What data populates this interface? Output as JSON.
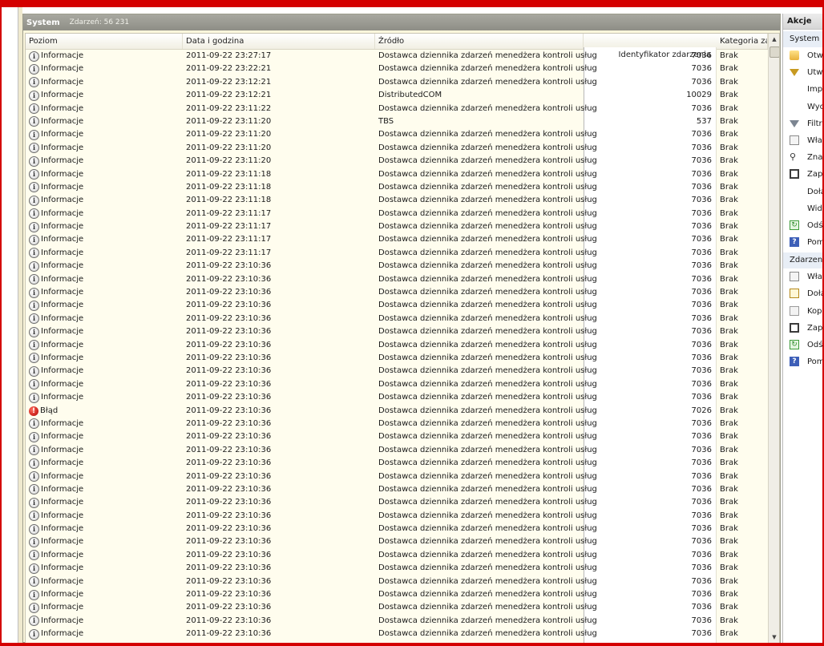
{
  "panel": {
    "title": "System",
    "count": "Zdarzeń: 56 231"
  },
  "columns": {
    "level": "Poziom",
    "date": "Data i godzina",
    "source": "Źródło",
    "event_id": "Identyfikator zdarzenia",
    "category": "Kategoria zad"
  },
  "rows": [
    {
      "level": "Informacje",
      "type": "info",
      "date": "2011-09-22 23:27:17",
      "source": "Dostawca dziennika zdarzeń menedżera kontroli usług",
      "id": "7036",
      "cat": "Brak"
    },
    {
      "level": "Informacje",
      "type": "info",
      "date": "2011-09-22 23:22:21",
      "source": "Dostawca dziennika zdarzeń menedżera kontroli usług",
      "id": "7036",
      "cat": "Brak"
    },
    {
      "level": "Informacje",
      "type": "info",
      "date": "2011-09-22 23:12:21",
      "source": "Dostawca dziennika zdarzeń menedżera kontroli usług",
      "id": "7036",
      "cat": "Brak"
    },
    {
      "level": "Informacje",
      "type": "info",
      "date": "2011-09-22 23:12:21",
      "source": "DistributedCOM",
      "id": "10029",
      "cat": "Brak"
    },
    {
      "level": "Informacje",
      "type": "info",
      "date": "2011-09-22 23:11:22",
      "source": "Dostawca dziennika zdarzeń menedżera kontroli usług",
      "id": "7036",
      "cat": "Brak"
    },
    {
      "level": "Informacje",
      "type": "info",
      "date": "2011-09-22 23:11:20",
      "source": "TBS",
      "id": "537",
      "cat": "Brak"
    },
    {
      "level": "Informacje",
      "type": "info",
      "date": "2011-09-22 23:11:20",
      "source": "Dostawca dziennika zdarzeń menedżera kontroli usług",
      "id": "7036",
      "cat": "Brak"
    },
    {
      "level": "Informacje",
      "type": "info",
      "date": "2011-09-22 23:11:20",
      "source": "Dostawca dziennika zdarzeń menedżera kontroli usług",
      "id": "7036",
      "cat": "Brak"
    },
    {
      "level": "Informacje",
      "type": "info",
      "date": "2011-09-22 23:11:20",
      "source": "Dostawca dziennika zdarzeń menedżera kontroli usług",
      "id": "7036",
      "cat": "Brak"
    },
    {
      "level": "Informacje",
      "type": "info",
      "date": "2011-09-22 23:11:18",
      "source": "Dostawca dziennika zdarzeń menedżera kontroli usług",
      "id": "7036",
      "cat": "Brak"
    },
    {
      "level": "Informacje",
      "type": "info",
      "date": "2011-09-22 23:11:18",
      "source": "Dostawca dziennika zdarzeń menedżera kontroli usług",
      "id": "7036",
      "cat": "Brak"
    },
    {
      "level": "Informacje",
      "type": "info",
      "date": "2011-09-22 23:11:18",
      "source": "Dostawca dziennika zdarzeń menedżera kontroli usług",
      "id": "7036",
      "cat": "Brak"
    },
    {
      "level": "Informacje",
      "type": "info",
      "date": "2011-09-22 23:11:17",
      "source": "Dostawca dziennika zdarzeń menedżera kontroli usług",
      "id": "7036",
      "cat": "Brak"
    },
    {
      "level": "Informacje",
      "type": "info",
      "date": "2011-09-22 23:11:17",
      "source": "Dostawca dziennika zdarzeń menedżera kontroli usług",
      "id": "7036",
      "cat": "Brak"
    },
    {
      "level": "Informacje",
      "type": "info",
      "date": "2011-09-22 23:11:17",
      "source": "Dostawca dziennika zdarzeń menedżera kontroli usług",
      "id": "7036",
      "cat": "Brak"
    },
    {
      "level": "Informacje",
      "type": "info",
      "date": "2011-09-22 23:11:17",
      "source": "Dostawca dziennika zdarzeń menedżera kontroli usług",
      "id": "7036",
      "cat": "Brak"
    },
    {
      "level": "Informacje",
      "type": "info",
      "date": "2011-09-22 23:10:36",
      "source": "Dostawca dziennika zdarzeń menedżera kontroli usług",
      "id": "7036",
      "cat": "Brak"
    },
    {
      "level": "Informacje",
      "type": "info",
      "date": "2011-09-22 23:10:36",
      "source": "Dostawca dziennika zdarzeń menedżera kontroli usług",
      "id": "7036",
      "cat": "Brak"
    },
    {
      "level": "Informacje",
      "type": "info",
      "date": "2011-09-22 23:10:36",
      "source": "Dostawca dziennika zdarzeń menedżera kontroli usług",
      "id": "7036",
      "cat": "Brak"
    },
    {
      "level": "Informacje",
      "type": "info",
      "date": "2011-09-22 23:10:36",
      "source": "Dostawca dziennika zdarzeń menedżera kontroli usług",
      "id": "7036",
      "cat": "Brak"
    },
    {
      "level": "Informacje",
      "type": "info",
      "date": "2011-09-22 23:10:36",
      "source": "Dostawca dziennika zdarzeń menedżera kontroli usług",
      "id": "7036",
      "cat": "Brak"
    },
    {
      "level": "Informacje",
      "type": "info",
      "date": "2011-09-22 23:10:36",
      "source": "Dostawca dziennika zdarzeń menedżera kontroli usług",
      "id": "7036",
      "cat": "Brak"
    },
    {
      "level": "Informacje",
      "type": "info",
      "date": "2011-09-22 23:10:36",
      "source": "Dostawca dziennika zdarzeń menedżera kontroli usług",
      "id": "7036",
      "cat": "Brak"
    },
    {
      "level": "Informacje",
      "type": "info",
      "date": "2011-09-22 23:10:36",
      "source": "Dostawca dziennika zdarzeń menedżera kontroli usług",
      "id": "7036",
      "cat": "Brak"
    },
    {
      "level": "Informacje",
      "type": "info",
      "date": "2011-09-22 23:10:36",
      "source": "Dostawca dziennika zdarzeń menedżera kontroli usług",
      "id": "7036",
      "cat": "Brak"
    },
    {
      "level": "Informacje",
      "type": "info",
      "date": "2011-09-22 23:10:36",
      "source": "Dostawca dziennika zdarzeń menedżera kontroli usług",
      "id": "7036",
      "cat": "Brak"
    },
    {
      "level": "Informacje",
      "type": "info",
      "date": "2011-09-22 23:10:36",
      "source": "Dostawca dziennika zdarzeń menedżera kontroli usług",
      "id": "7036",
      "cat": "Brak"
    },
    {
      "level": "Błąd",
      "type": "error",
      "date": "2011-09-22 23:10:36",
      "source": "Dostawca dziennika zdarzeń menedżera kontroli usług",
      "id": "7026",
      "cat": "Brak"
    },
    {
      "level": "Informacje",
      "type": "info",
      "date": "2011-09-22 23:10:36",
      "source": "Dostawca dziennika zdarzeń menedżera kontroli usług",
      "id": "7036",
      "cat": "Brak"
    },
    {
      "level": "Informacje",
      "type": "info",
      "date": "2011-09-22 23:10:36",
      "source": "Dostawca dziennika zdarzeń menedżera kontroli usług",
      "id": "7036",
      "cat": "Brak"
    },
    {
      "level": "Informacje",
      "type": "info",
      "date": "2011-09-22 23:10:36",
      "source": "Dostawca dziennika zdarzeń menedżera kontroli usług",
      "id": "7036",
      "cat": "Brak"
    },
    {
      "level": "Informacje",
      "type": "info",
      "date": "2011-09-22 23:10:36",
      "source": "Dostawca dziennika zdarzeń menedżera kontroli usług",
      "id": "7036",
      "cat": "Brak"
    },
    {
      "level": "Informacje",
      "type": "info",
      "date": "2011-09-22 23:10:36",
      "source": "Dostawca dziennika zdarzeń menedżera kontroli usług",
      "id": "7036",
      "cat": "Brak"
    },
    {
      "level": "Informacje",
      "type": "info",
      "date": "2011-09-22 23:10:36",
      "source": "Dostawca dziennika zdarzeń menedżera kontroli usług",
      "id": "7036",
      "cat": "Brak"
    },
    {
      "level": "Informacje",
      "type": "info",
      "date": "2011-09-22 23:10:36",
      "source": "Dostawca dziennika zdarzeń menedżera kontroli usług",
      "id": "7036",
      "cat": "Brak"
    },
    {
      "level": "Informacje",
      "type": "info",
      "date": "2011-09-22 23:10:36",
      "source": "Dostawca dziennika zdarzeń menedżera kontroli usług",
      "id": "7036",
      "cat": "Brak"
    },
    {
      "level": "Informacje",
      "type": "info",
      "date": "2011-09-22 23:10:36",
      "source": "Dostawca dziennika zdarzeń menedżera kontroli usług",
      "id": "7036",
      "cat": "Brak"
    },
    {
      "level": "Informacje",
      "type": "info",
      "date": "2011-09-22 23:10:36",
      "source": "Dostawca dziennika zdarzeń menedżera kontroli usług",
      "id": "7036",
      "cat": "Brak"
    },
    {
      "level": "Informacje",
      "type": "info",
      "date": "2011-09-22 23:10:36",
      "source": "Dostawca dziennika zdarzeń menedżera kontroli usług",
      "id": "7036",
      "cat": "Brak"
    },
    {
      "level": "Informacje",
      "type": "info",
      "date": "2011-09-22 23:10:36",
      "source": "Dostawca dziennika zdarzeń menedżera kontroli usług",
      "id": "7036",
      "cat": "Brak"
    },
    {
      "level": "Informacje",
      "type": "info",
      "date": "2011-09-22 23:10:36",
      "source": "Dostawca dziennika zdarzeń menedżera kontroli usług",
      "id": "7036",
      "cat": "Brak"
    },
    {
      "level": "Informacje",
      "type": "info",
      "date": "2011-09-22 23:10:36",
      "source": "Dostawca dziennika zdarzeń menedżera kontroli usług",
      "id": "7036",
      "cat": "Brak"
    },
    {
      "level": "Informacje",
      "type": "info",
      "date": "2011-09-22 23:10:36",
      "source": "Dostawca dziennika zdarzeń menedżera kontroli usług",
      "id": "7036",
      "cat": "Brak"
    },
    {
      "level": "Informacje",
      "type": "info",
      "date": "2011-09-22 23:10:36",
      "source": "Dostawca dziennika zdarzeń menedżera kontroli usług",
      "id": "7036",
      "cat": "Brak"
    },
    {
      "level": "Informacje",
      "type": "info",
      "date": "2011-09-22 23:10:36",
      "source": "Dostawca dziennika zdarzeń menedżera kontroli usług",
      "id": "7036",
      "cat": "Brak"
    }
  ],
  "actions": {
    "title": "Akcje",
    "section_system": "System",
    "system_items": [
      {
        "label": "Otw",
        "icon": "folder-open-icon"
      },
      {
        "label": "Utw",
        "icon": "create-filter-icon"
      },
      {
        "label": "Impo",
        "icon": "none"
      },
      {
        "label": "Wyc",
        "icon": "none"
      },
      {
        "label": "Filtru",
        "icon": "filter-icon"
      },
      {
        "label": "Właś",
        "icon": "properties-icon"
      },
      {
        "label": "Znaj",
        "icon": "find-icon"
      },
      {
        "label": "Zapi",
        "icon": "save-icon"
      },
      {
        "label": "Dołą",
        "icon": "none"
      },
      {
        "label": "Wido",
        "icon": "none"
      },
      {
        "label": "Odśv",
        "icon": "refresh-icon"
      },
      {
        "label": "Pom",
        "icon": "help-icon"
      }
    ],
    "section_event": "Zdarzenie",
    "event_items": [
      {
        "label": "Właś",
        "icon": "properties-icon"
      },
      {
        "label": "Dołą",
        "icon": "attach-task-icon"
      },
      {
        "label": "Kopi",
        "icon": "copy-icon"
      },
      {
        "label": "Zapi",
        "icon": "save-icon"
      },
      {
        "label": "Odśv",
        "icon": "refresh-icon"
      },
      {
        "label": "Pom",
        "icon": "help-icon"
      }
    ]
  }
}
